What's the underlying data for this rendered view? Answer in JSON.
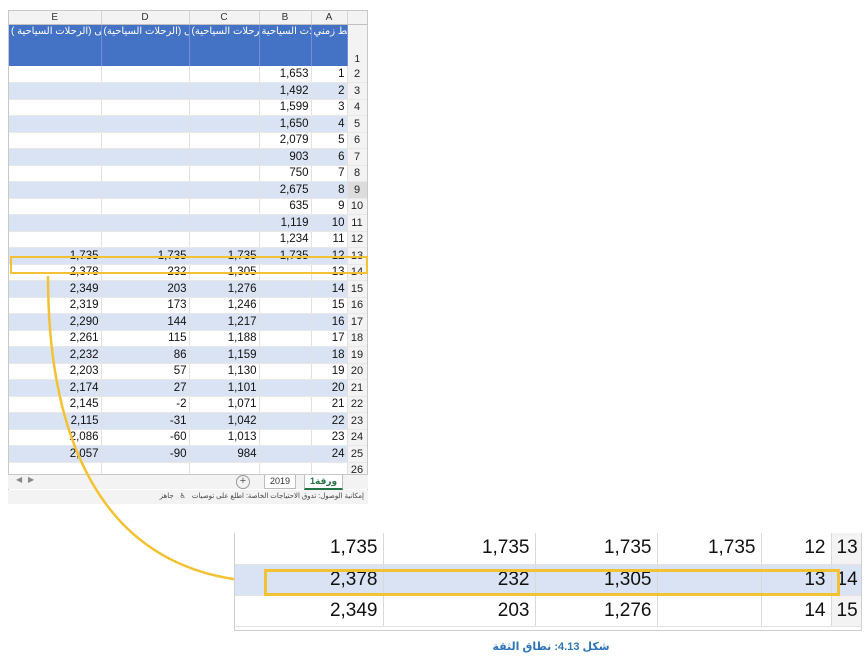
{
  "columns": [
    "E",
    "D",
    "C",
    "B",
    "A"
  ],
  "headers": {
    "E": "الضمام الثقة الأعلى (الرحلات السياحية )",
    "D": "الضمام الثقة الأدنى (الرحلات السياحية)",
    "C": "التنبؤ (الرحلات السياحية)",
    "B": "الرحلات السياحية",
    "A": "خط زمني"
  },
  "rows": [
    {
      "rn": "2",
      "A": "1",
      "B": "1,653",
      "C": "",
      "D": "",
      "E": ""
    },
    {
      "rn": "3",
      "A": "2",
      "B": "1,492",
      "C": "",
      "D": "",
      "E": ""
    },
    {
      "rn": "4",
      "A": "3",
      "B": "1,599",
      "C": "",
      "D": "",
      "E": ""
    },
    {
      "rn": "5",
      "A": "4",
      "B": "1,650",
      "C": "",
      "D": "",
      "E": ""
    },
    {
      "rn": "6",
      "A": "5",
      "B": "2,079",
      "C": "",
      "D": "",
      "E": ""
    },
    {
      "rn": "7",
      "A": "6",
      "B": "903",
      "C": "",
      "D": "",
      "E": ""
    },
    {
      "rn": "8",
      "A": "7",
      "B": "750",
      "C": "",
      "D": "",
      "E": ""
    },
    {
      "rn": "9",
      "A": "8",
      "B": "2,675",
      "C": "",
      "D": "",
      "E": ""
    },
    {
      "rn": "10",
      "A": "9",
      "B": "635",
      "C": "",
      "D": "",
      "E": ""
    },
    {
      "rn": "11",
      "A": "10",
      "B": "1,119",
      "C": "",
      "D": "",
      "E": ""
    },
    {
      "rn": "12",
      "A": "11",
      "B": "1,234",
      "C": "",
      "D": "",
      "E": ""
    },
    {
      "rn": "13",
      "A": "12",
      "B": "1,735",
      "C": "1,735",
      "D": "1,735",
      "E": "1,735"
    },
    {
      "rn": "14",
      "A": "13",
      "B": "",
      "C": "1,305",
      "D": "232",
      "E": "2,378"
    },
    {
      "rn": "15",
      "A": "14",
      "B": "",
      "C": "1,276",
      "D": "203",
      "E": "2,349"
    },
    {
      "rn": "16",
      "A": "15",
      "B": "",
      "C": "1,246",
      "D": "173",
      "E": "2,319"
    },
    {
      "rn": "17",
      "A": "16",
      "B": "",
      "C": "1,217",
      "D": "144",
      "E": "2,290"
    },
    {
      "rn": "18",
      "A": "17",
      "B": "",
      "C": "1,188",
      "D": "115",
      "E": "2,261"
    },
    {
      "rn": "19",
      "A": "18",
      "B": "",
      "C": "1,159",
      "D": "86",
      "E": "2,232"
    },
    {
      "rn": "20",
      "A": "19",
      "B": "",
      "C": "1,130",
      "D": "57",
      "E": "2,203"
    },
    {
      "rn": "21",
      "A": "20",
      "B": "",
      "C": "1,101",
      "D": "27",
      "E": "2,174"
    },
    {
      "rn": "22",
      "A": "21",
      "B": "",
      "C": "1,071",
      "D": "-2",
      "E": "2,145"
    },
    {
      "rn": "23",
      "A": "22",
      "B": "",
      "C": "1,042",
      "D": "-31",
      "E": "2,115"
    },
    {
      "rn": "24",
      "A": "23",
      "B": "",
      "C": "1,013",
      "D": "-60",
      "E": "2,086"
    },
    {
      "rn": "25",
      "A": "24",
      "B": "",
      "C": "984",
      "D": "-90",
      "E": "2,057"
    },
    {
      "rn": "26",
      "A": "",
      "B": "",
      "C": "",
      "D": "",
      "E": ""
    }
  ],
  "header_row_number": "1",
  "tabs": {
    "active": "ورقة1",
    "other": "2019",
    "add": "+"
  },
  "status": {
    "ready": "جاهز",
    "accessibility": "إمكانية الوصول: تدوق الاحتياجات الخاصة: اطلع على توصيات"
  },
  "zoom_rows": [
    {
      "rn": "13",
      "A": "12",
      "B": "1,735",
      "C": "1,735",
      "D": "1,735",
      "E": "1,735"
    },
    {
      "rn": "14",
      "A": "13",
      "B": "",
      "C": "1,305",
      "D": "232",
      "E": "2,378"
    },
    {
      "rn": "15",
      "A": "14",
      "B": "",
      "C": "1,276",
      "D": "203",
      "E": "2,349"
    }
  ],
  "caption": "شكل 4.13: نطاق الثقة",
  "colors": {
    "header_blue": "#4472c4",
    "band": "#dae3f3",
    "highlight": "#f3c234",
    "caption": "#2e75b6"
  }
}
